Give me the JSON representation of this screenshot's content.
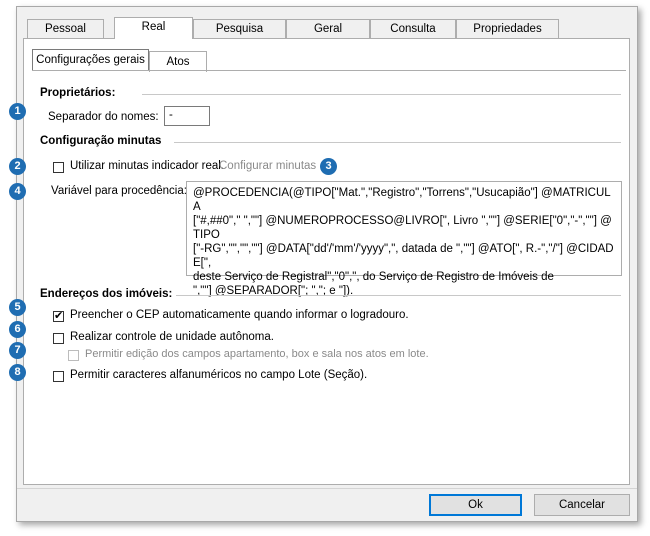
{
  "tabs": [
    "Pessoal",
    "Real",
    "Pesquisa",
    "Geral",
    "Consulta",
    "Propriedades"
  ],
  "subtabs": [
    "Configurações gerais",
    "Atos"
  ],
  "sections": {
    "proprietarios": "Proprietários:",
    "minutas": "Configuração minutas",
    "enderecos": "Endereços dos imóveis:"
  },
  "proprietarios": {
    "separador_label": "Separador do nomes:",
    "separador_value": "-"
  },
  "minutas": {
    "utilizar_label": "Utilizar minutas indicador real.",
    "utilizar_checked": false,
    "configurar_link": "Configurar minutas",
    "variavel_label": "Variável para procedência:",
    "variavel_value": "@PROCEDENCIA(@TIPO[\"Mat.\",\"Registro\",\"Torrens\",\"Usucapião\"] @MATRICULA\n[\"#,##0\",\" \",\"\"] @NUMEROPROCESSO@LIVRO[\", Livro \",\"\"] @SERIE[\"0\",\"-\",\"\"] @TIPO\n[\"-RG\",\"\",\"\",\"\"] @DATA[\"dd'/'mm'/'yyyy\",\", datada de \",\"\"] @ATO[\", R.-\",\"/\"] @CIDADE[\",\ndeste Serviço de Registral\",\"0\",\", do Serviço de Registro de Imóveis de\n\",\"\"] @SEPARADOR[\"; \",\"; e \"])."
  },
  "enderecos": {
    "cep_label": "Preencher o CEP automaticamente quando informar o logradouro.",
    "cep_checked": true,
    "unidade_label": "Realizar controle de unidade autônoma.",
    "unidade_checked": false,
    "edicao_label": "Permitir edição dos campos apartamento, box e sala nos atos em lote.",
    "edicao_checked": false,
    "lote_label": "Permitir caracteres alfanuméricos no campo Lote (Seção).",
    "lote_checked": false
  },
  "badges": [
    "1",
    "2",
    "3",
    "4",
    "5",
    "6",
    "7",
    "8"
  ],
  "buttons": {
    "ok": "Ok",
    "cancel": "Cancelar"
  },
  "colors": {
    "badge": "#1f6db2",
    "default_button_border": "#0078d7"
  }
}
